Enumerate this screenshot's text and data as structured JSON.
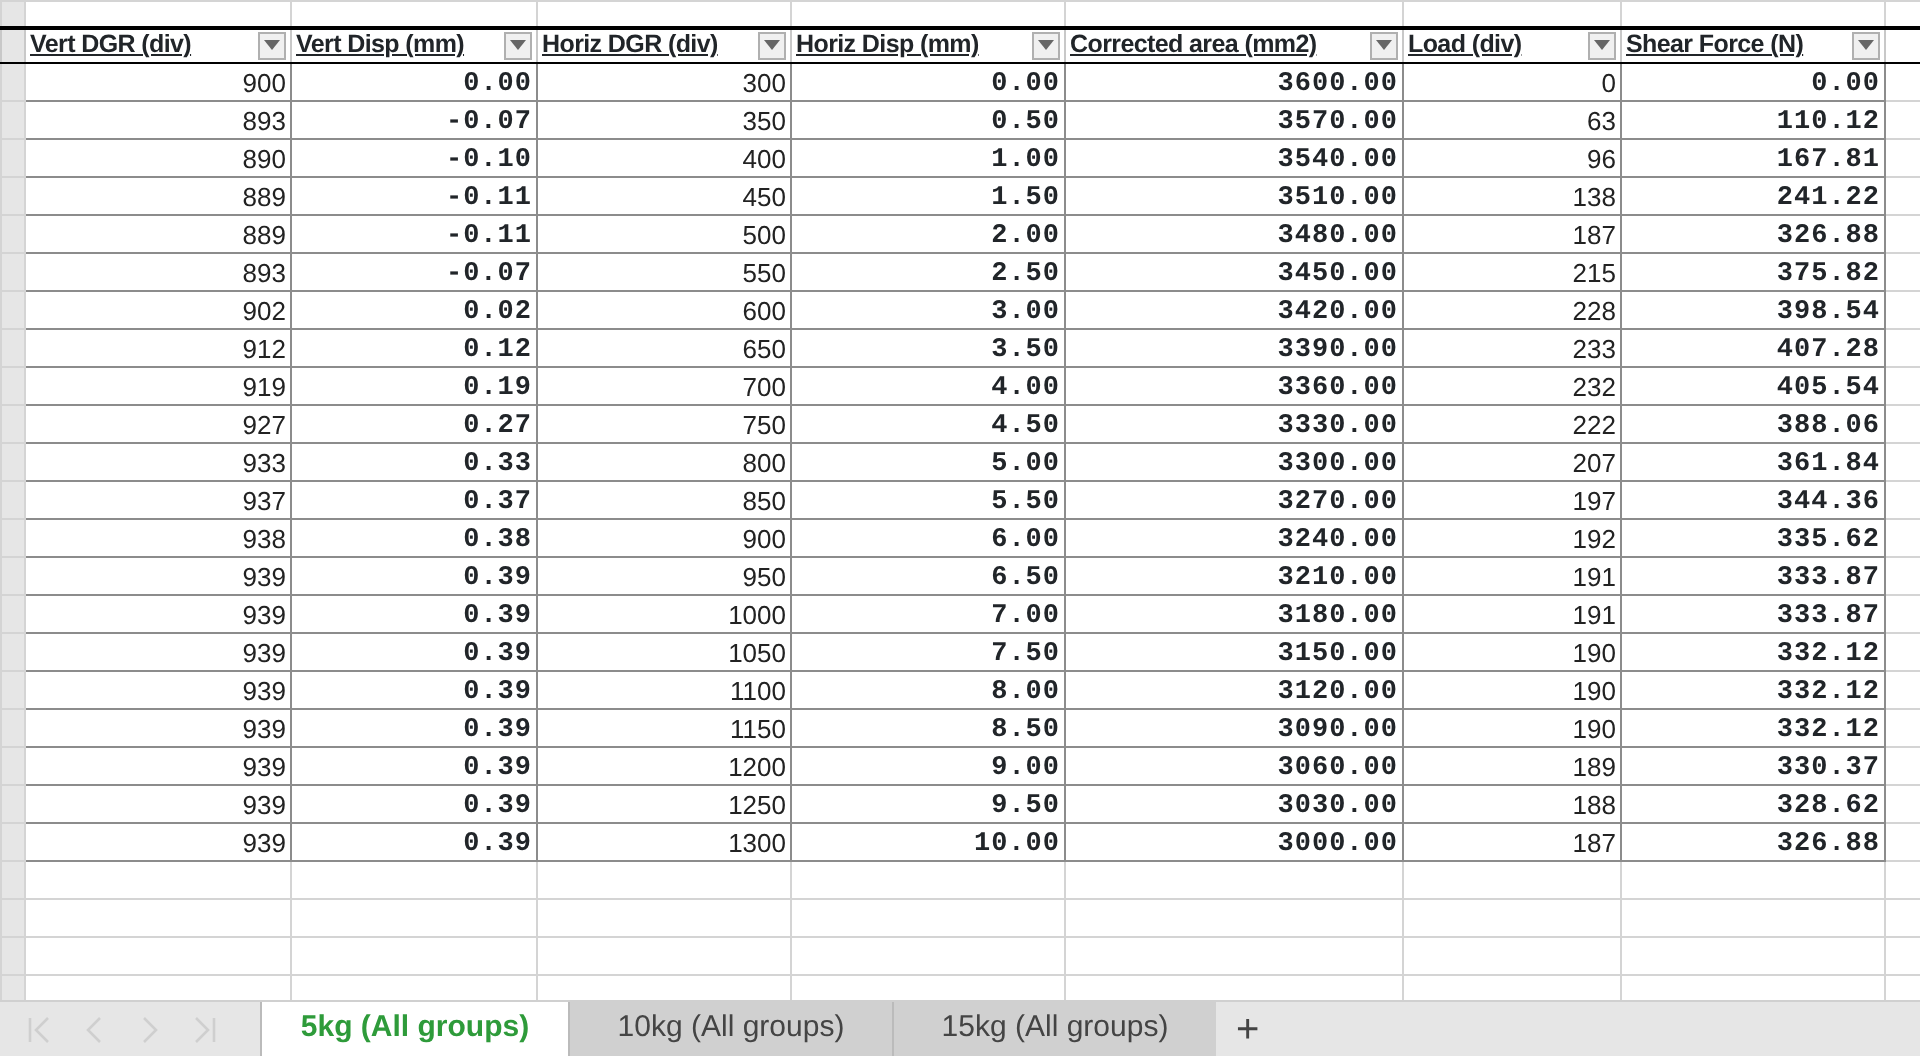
{
  "table": {
    "columns": [
      {
        "label": "Vert DGR (div)",
        "kind": "int"
      },
      {
        "label": "Vert Disp (mm)",
        "kind": "decimal"
      },
      {
        "label": "Horiz DGR (div)",
        "kind": "int"
      },
      {
        "label": "Horiz Disp (mm)",
        "kind": "decimal"
      },
      {
        "label": "Corrected area (mm2)",
        "kind": "decimal"
      },
      {
        "label": "Load (div)",
        "kind": "int"
      },
      {
        "label": "Shear Force (N)",
        "kind": "decimal"
      }
    ],
    "rows": [
      [
        "900",
        "0.00",
        "300",
        "0.00",
        "3600.00",
        "0",
        "0.00"
      ],
      [
        "893",
        "-0.07",
        "350",
        "0.50",
        "3570.00",
        "63",
        "110.12"
      ],
      [
        "890",
        "-0.10",
        "400",
        "1.00",
        "3540.00",
        "96",
        "167.81"
      ],
      [
        "889",
        "-0.11",
        "450",
        "1.50",
        "3510.00",
        "138",
        "241.22"
      ],
      [
        "889",
        "-0.11",
        "500",
        "2.00",
        "3480.00",
        "187",
        "326.88"
      ],
      [
        "893",
        "-0.07",
        "550",
        "2.50",
        "3450.00",
        "215",
        "375.82"
      ],
      [
        "902",
        "0.02",
        "600",
        "3.00",
        "3420.00",
        "228",
        "398.54"
      ],
      [
        "912",
        "0.12",
        "650",
        "3.50",
        "3390.00",
        "233",
        "407.28"
      ],
      [
        "919",
        "0.19",
        "700",
        "4.00",
        "3360.00",
        "232",
        "405.54"
      ],
      [
        "927",
        "0.27",
        "750",
        "4.50",
        "3330.00",
        "222",
        "388.06"
      ],
      [
        "933",
        "0.33",
        "800",
        "5.00",
        "3300.00",
        "207",
        "361.84"
      ],
      [
        "937",
        "0.37",
        "850",
        "5.50",
        "3270.00",
        "197",
        "344.36"
      ],
      [
        "938",
        "0.38",
        "900",
        "6.00",
        "3240.00",
        "192",
        "335.62"
      ],
      [
        "939",
        "0.39",
        "950",
        "6.50",
        "3210.00",
        "191",
        "333.87"
      ],
      [
        "939",
        "0.39",
        "1000",
        "7.00",
        "3180.00",
        "191",
        "333.87"
      ],
      [
        "939",
        "0.39",
        "1050",
        "7.50",
        "3150.00",
        "190",
        "332.12"
      ],
      [
        "939",
        "0.39",
        "1100",
        "8.00",
        "3120.00",
        "190",
        "332.12"
      ],
      [
        "939",
        "0.39",
        "1150",
        "8.50",
        "3090.00",
        "190",
        "332.12"
      ],
      [
        "939",
        "0.39",
        "1200",
        "9.00",
        "3060.00",
        "189",
        "330.37"
      ],
      [
        "939",
        "0.39",
        "1250",
        "9.50",
        "3030.00",
        "188",
        "328.62"
      ],
      [
        "939",
        "0.39",
        "1300",
        "10.00",
        "3000.00",
        "187",
        "326.88"
      ]
    ]
  },
  "sheet_tabs": [
    {
      "label": "5kg (All groups)",
      "selected": true
    },
    {
      "label": "10kg (All groups)",
      "selected": false
    },
    {
      "label": "15kg (All groups)",
      "selected": false
    }
  ],
  "add_sheet": "+"
}
